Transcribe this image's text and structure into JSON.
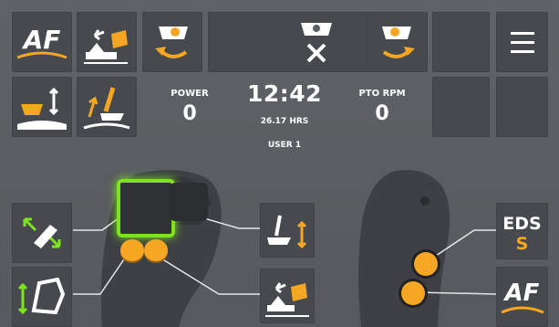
{
  "status": {
    "power_label": "POWER",
    "power_value": "0",
    "time": "12:42",
    "hours": "26.17 HRS",
    "user": "USER 1",
    "pto_label": "PTO RPM",
    "pto_value": "0"
  },
  "buttons": {
    "af_top": "AF",
    "af_bottom": "AF",
    "eds_title": "EDS",
    "eds_sub": "S"
  },
  "colors": {
    "accent": "#f5a623",
    "tile": "#46494d",
    "background": "#5b5e62",
    "highlight_green": "#7ee21f"
  }
}
